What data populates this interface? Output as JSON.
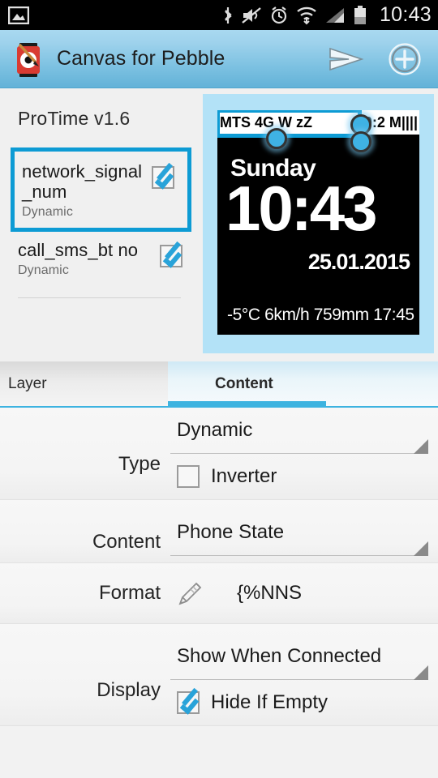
{
  "statusbar": {
    "clock": "10:43",
    "icons": [
      "image-icon",
      "bluetooth-icon",
      "mute-icon",
      "alarm-icon",
      "wifi-icon",
      "signal-icon",
      "battery-icon"
    ]
  },
  "actionbar": {
    "title": "Canvas for Pebble",
    "app_icon": "pebble-paint-icon",
    "actions": [
      "send-icon",
      "add-circle-icon"
    ]
  },
  "layer_pane": {
    "title": "ProTime v1.6",
    "items": [
      {
        "name": "network_signal_num",
        "type": "Dynamic",
        "checked": true,
        "selected": true
      },
      {
        "name": "call_sms_bt no",
        "type": "Dynamic",
        "checked": true,
        "selected": false
      }
    ]
  },
  "preview": {
    "topbar_left": "MTS 4G W zZ",
    "topbar_right": "0:2 M||||",
    "day": "Sunday",
    "time": "10:43",
    "date": "25.01.2015",
    "weather": "-5°C 6km/h 759mm 17:45"
  },
  "tabs": [
    {
      "label": "Layer",
      "active": false
    },
    {
      "label": "Content",
      "active": true
    }
  ],
  "form": {
    "type": {
      "label": "Type",
      "value": "Dynamic"
    },
    "inverter": {
      "label": "Inverter",
      "checked": false
    },
    "content": {
      "label": "Content",
      "value": "Phone State"
    },
    "format": {
      "label": "Format",
      "value": "{%NNS",
      "icon": "pencil-icon"
    },
    "display": {
      "label": "Display",
      "value": "Show When Connected"
    },
    "hide_if_empty": {
      "label": "Hide If Empty",
      "checked": true
    }
  },
  "colors": {
    "accent": "#0d9bd4",
    "actionbar": "#9ed2ec",
    "preview_frame": "#b3e2f7",
    "tab_indicator": "#3db3e0"
  }
}
